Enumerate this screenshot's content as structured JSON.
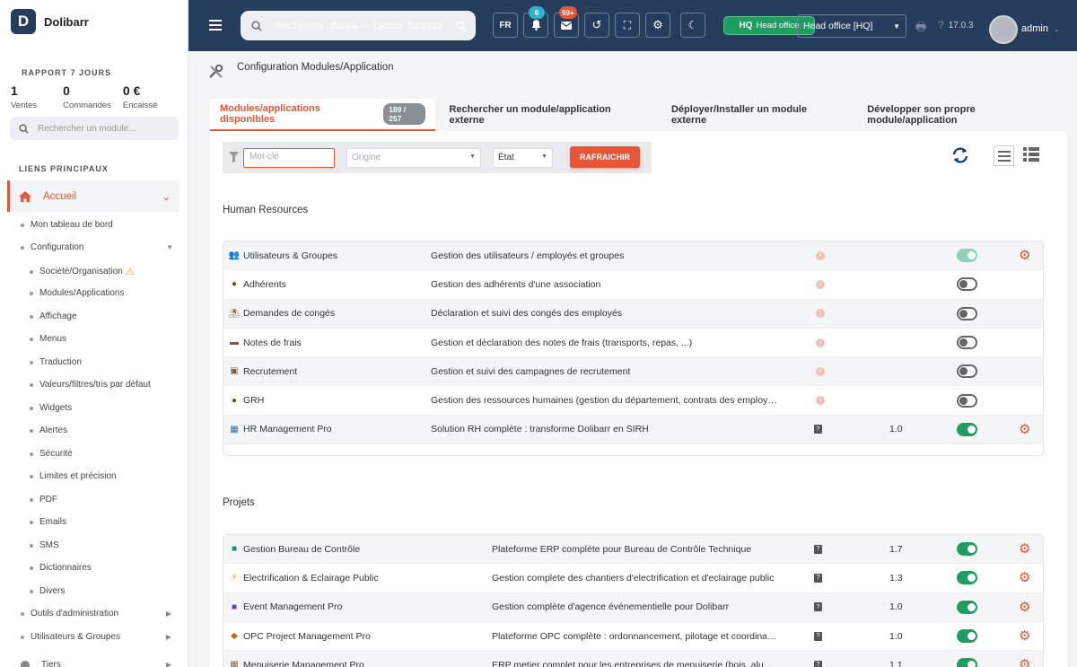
{
  "brand": {
    "name": "Dolibarr",
    "logo_letter": "D"
  },
  "report": {
    "title": "RAPPORT 7 JOURS",
    "kpis": [
      {
        "value": "1",
        "label": "Ventes"
      },
      {
        "value": "0",
        "label": "Commandes"
      },
      {
        "value": "0 €",
        "label": "Encaissé"
      }
    ]
  },
  "sidebar_search": {
    "placeholder": "Rechercher un module..."
  },
  "nav_section": "LIENS PRINCIPAUX",
  "nav_main": {
    "label": "Accueil"
  },
  "nav": {
    "tableau": "Mon tableau de bord",
    "configuration": "Configuration",
    "societe": "Société/Organisation",
    "modules": "Modules/Applications",
    "affichage": "Affichage",
    "menus": "Menus",
    "traduction": "Traduction",
    "valeurs": "Valeurs/filtres/tris par défaut",
    "widgets": "Widgets",
    "alertes": "Alertes",
    "securite": "Sécurité",
    "limites": "Limites et précision",
    "pdf": "PDF",
    "emails": "Emails",
    "sms": "SMS",
    "dictionnaires": "Dictionnaires",
    "divers": "Divers",
    "outils": "Outils d'administration",
    "utilisateurs": "Utilisateurs & Groupes",
    "tiers": "Tiers"
  },
  "topbar": {
    "search_placeholder": "Recherche globale — clients, factures",
    "lang": "FR",
    "notif_count": "6",
    "mail_count": "99+",
    "hq_tag": "HQ",
    "hq_label": "Head office",
    "entity_select": "Head office [HQ]",
    "version": "17.0.3",
    "user": "admin"
  },
  "page": {
    "title": "Configuration Modules/Application",
    "tabs": [
      {
        "label": "Modules/applications disponibles",
        "count": "189 / 257"
      },
      {
        "label": "Rechercher un module/application externe"
      },
      {
        "label": "Déployer/Installer un module externe"
      },
      {
        "label": "Développer son propre module/application"
      }
    ]
  },
  "filters": {
    "keyword_placeholder": "Mot-clé",
    "origin_placeholder": "Origine",
    "state_label": "État",
    "refresh_label": "RAFRAICHIR"
  },
  "sections": [
    {
      "title": "Human Resources",
      "rows": [
        {
          "icon": "users-icon",
          "name": "Utilisateurs & Groupes",
          "desc": "Gestion des utilisateurs / employés et groupes",
          "version": "",
          "state": "dim",
          "gear": true
        },
        {
          "icon": "user-icon",
          "name": "Adhérents",
          "desc": "Gestion des adhérents d'une association",
          "version": "",
          "state": "off",
          "gear": false
        },
        {
          "icon": "beach-icon",
          "name": "Demandes de congés",
          "desc": "Déclaration et suivi des congés des employés",
          "version": "",
          "state": "off",
          "gear": false
        },
        {
          "icon": "wallet-icon",
          "name": "Notes de frais",
          "desc": "Gestion et déclaration des notes de frais (transports, repas, ...)",
          "version": "",
          "state": "off",
          "gear": false
        },
        {
          "icon": "recruitment-icon",
          "name": "Recrutement",
          "desc": "Gestion et suivi des campagnes de recrutement",
          "version": "",
          "state": "off",
          "gear": false
        },
        {
          "icon": "user-tie-icon",
          "name": "GRH",
          "desc": "Gestion des ressources humaines (gestion du département, contrats des employ…",
          "version": "",
          "state": "off",
          "gear": false
        },
        {
          "icon": "hr-pro-icon",
          "name": "HR Management Pro",
          "desc": "Solution RH complète : transforme Dolibarr en SIRH",
          "version": "1.0",
          "state": "on",
          "gear": true,
          "external": true
        }
      ]
    },
    {
      "title": "Projets",
      "rows": [
        {
          "icon": "shield-check-icon",
          "name": "Gestion Bureau de Contrôle",
          "desc": "Plateforme ERP complète pour Bureau de Contrôle Technique",
          "version": "1.7",
          "state": "on",
          "gear": true,
          "external": true
        },
        {
          "icon": "lightning-icon",
          "name": "Electrification & Eclairage Public",
          "desc": "Gestion complete des chantiers d'electrification et d'eclairage public",
          "version": "1.3",
          "state": "on",
          "gear": true,
          "external": true
        },
        {
          "icon": "event-icon",
          "name": "Event Management Pro",
          "desc": "Gestion complète d'agence événementielle pour Dolibarr",
          "version": "1.0",
          "state": "on",
          "gear": true,
          "external": true
        },
        {
          "icon": "opc-icon",
          "name": "OPC Project Management Pro",
          "desc": "Plateforme OPC complète : ordonnancement, pilotage et coordina…",
          "version": "1.0",
          "state": "on",
          "gear": true,
          "external": true
        },
        {
          "icon": "carpentry-icon",
          "name": "Menuiserie Management Pro",
          "desc": "ERP metier complet pour les entreprises de menuiserie (bois, alu…",
          "version": "1.1",
          "state": "on",
          "gear": true,
          "external": true
        }
      ]
    }
  ]
}
